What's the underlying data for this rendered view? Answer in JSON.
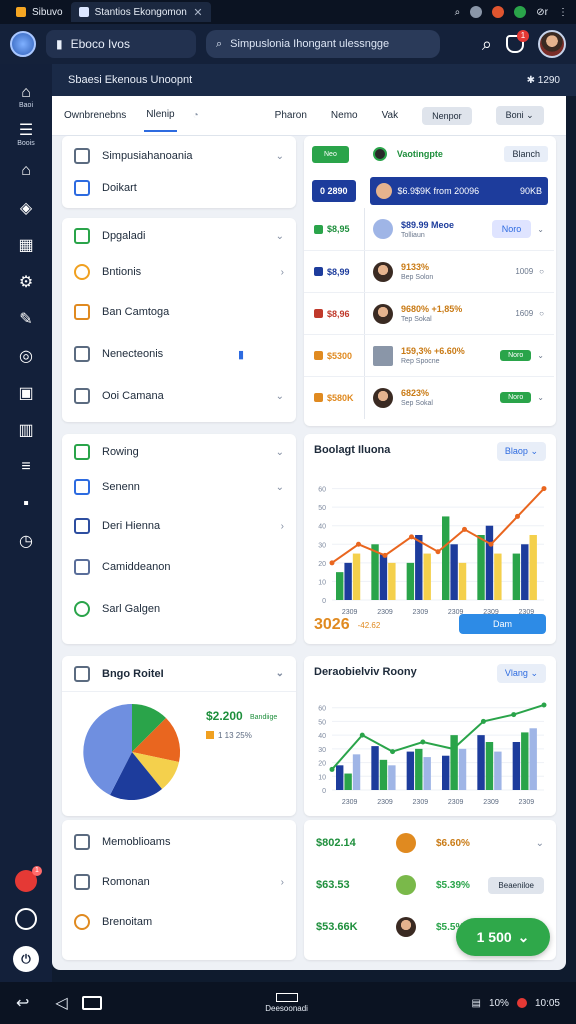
{
  "status": {
    "tab1": "Sibuvo",
    "tab2": "Stantios Ekongomon",
    "tab_close": "✕",
    "right1": "⌕",
    "right2": "◐",
    "right3": "⚙",
    "right4": "⋮",
    "time": "⊘r",
    "more": "⋮"
  },
  "appbar": {
    "appname": "Eboco Ivos",
    "search_placeholder": "Simpuslonia Ihongant ulessngge",
    "notif_count": "1"
  },
  "sidebar": {
    "items": [
      {
        "icon": "⌂",
        "label": "Baoi"
      },
      {
        "icon": "☰",
        "label": "Boois"
      },
      {
        "icon": "⌂",
        "label": ""
      },
      {
        "icon": "◈",
        "label": ""
      },
      {
        "icon": "▦",
        "label": ""
      },
      {
        "icon": "⚙",
        "label": ""
      },
      {
        "icon": "✎",
        "label": ""
      },
      {
        "icon": "◎",
        "label": ""
      },
      {
        "icon": "▣",
        "label": ""
      },
      {
        "icon": "▥",
        "label": ""
      },
      {
        "icon": "≡",
        "label": ""
      },
      {
        "icon": "▪",
        "label": ""
      },
      {
        "icon": "◷",
        "label": ""
      }
    ],
    "bottom_badge": "1"
  },
  "subhead": {
    "title": "Sbaesi Ekenous Unoopnt",
    "right": "✱ 1290"
  },
  "toptabs": {
    "tab1": "Ownbrenebns",
    "tab2": "Nlenip",
    "tab3": "Pharon",
    "tab4": "Nemo",
    "tab5": "Vak",
    "tab6": "Nenpor",
    "tab7": "Boni"
  },
  "left_panel": {
    "card1": [
      {
        "label": "Simpusiahanoania"
      },
      {
        "label": "Doikart"
      }
    ],
    "card2": [
      {
        "label": "Dpgaladi"
      },
      {
        "label": "Bntionis"
      },
      {
        "label": "Ban Camtoga"
      },
      {
        "label": "Nenecteonis"
      },
      {
        "label": "Ooi Camana"
      }
    ],
    "card3": [
      {
        "label": "Rowing"
      },
      {
        "label": "Senenn"
      },
      {
        "label": "Deri Hienna"
      },
      {
        "label": "Camiddeanon"
      },
      {
        "label": "Sarl Galgen"
      }
    ],
    "card4_title": "Bngo RoiteI",
    "pie_value": "$2.200",
    "pie_legend": "Bandiige",
    "pie_sub": "1 13 25%",
    "card5": [
      {
        "label": "Memoblioams"
      },
      {
        "label": "Romonan"
      },
      {
        "label": "Brenoitam"
      }
    ]
  },
  "right_list": {
    "header_btn": "Neo",
    "header_name": "Vaotingpte",
    "header_right": "Blanch",
    "highlight_val": "0 2890",
    "highlight_txt": "$6.9$9K from 20096",
    "highlight_right": "90KB",
    "rows": [
      {
        "val": "$8,95",
        "title": "$89.99 Meoe",
        "sub": "Tolliaun",
        "end": "Noro"
      },
      {
        "val": "$8,99",
        "title": "9133%",
        "sub": "Bep Solon",
        "end": "1009"
      },
      {
        "val": "$8,96",
        "title": "9680% +1,85%",
        "sub": "Tep Sokal",
        "end": "1609"
      },
      {
        "val": "$5300",
        "title": "159,3% +6.60%",
        "sub": "Rep Spocne",
        "end": "Noro"
      },
      {
        "val": "$580K",
        "title": "6823%",
        "sub": "Sep Sokal",
        "end": "Noro"
      }
    ]
  },
  "bar_chart": {
    "title": "Boolagt Iluona",
    "dd": "Blaop",
    "total": "3026",
    "total_sub": "-42.62",
    "button": "Dam"
  },
  "combo_chart": {
    "title": "Deraobielviv Roony",
    "dd": "Vlang"
  },
  "bottom_list": [
    {
      "val": "$802.14",
      "pct": "$6.60%"
    },
    {
      "val": "$63.53",
      "pct": "$5.39%",
      "btn": "Beaeniloe"
    },
    {
      "val": "$53.66K",
      "pct": "$5.5%"
    }
  ],
  "fab": "1 500",
  "navbar": {
    "center": "Deesoonadi",
    "right1": "10%",
    "right2": "10:05"
  },
  "chart_data": [
    {
      "type": "bar",
      "categories": [
        "2309",
        "2309",
        "2309",
        "2309",
        "2309",
        "2309"
      ],
      "series": [
        {
          "values": [
            15,
            30,
            20,
            45,
            35,
            25
          ]
        },
        {
          "values": [
            20,
            25,
            35,
            30,
            40,
            30
          ]
        },
        {
          "values": [
            25,
            20,
            25,
            20,
            25,
            35
          ]
        }
      ],
      "line": [
        20,
        30,
        24,
        34,
        26,
        38,
        30,
        45,
        60
      ],
      "ylim": [
        0,
        70
      ],
      "yticks": [
        "0",
        "10",
        "20",
        "30",
        "40",
        "50",
        "60"
      ]
    },
    {
      "type": "bar",
      "categories": [
        "2309",
        "2309",
        "2309",
        "2309",
        "2309",
        "2309"
      ],
      "series": [
        {
          "values": [
            18,
            32,
            28,
            25,
            40,
            35
          ]
        },
        {
          "values": [
            12,
            22,
            30,
            40,
            35,
            42
          ]
        },
        {
          "values": [
            26,
            18,
            24,
            30,
            28,
            45
          ]
        }
      ],
      "line": [
        15,
        40,
        28,
        35,
        30,
        50,
        55,
        62
      ],
      "ylim": [
        0,
        70
      ],
      "yticks": [
        "0",
        "10",
        "20",
        "30",
        "40",
        "50",
        "60"
      ]
    }
  ]
}
